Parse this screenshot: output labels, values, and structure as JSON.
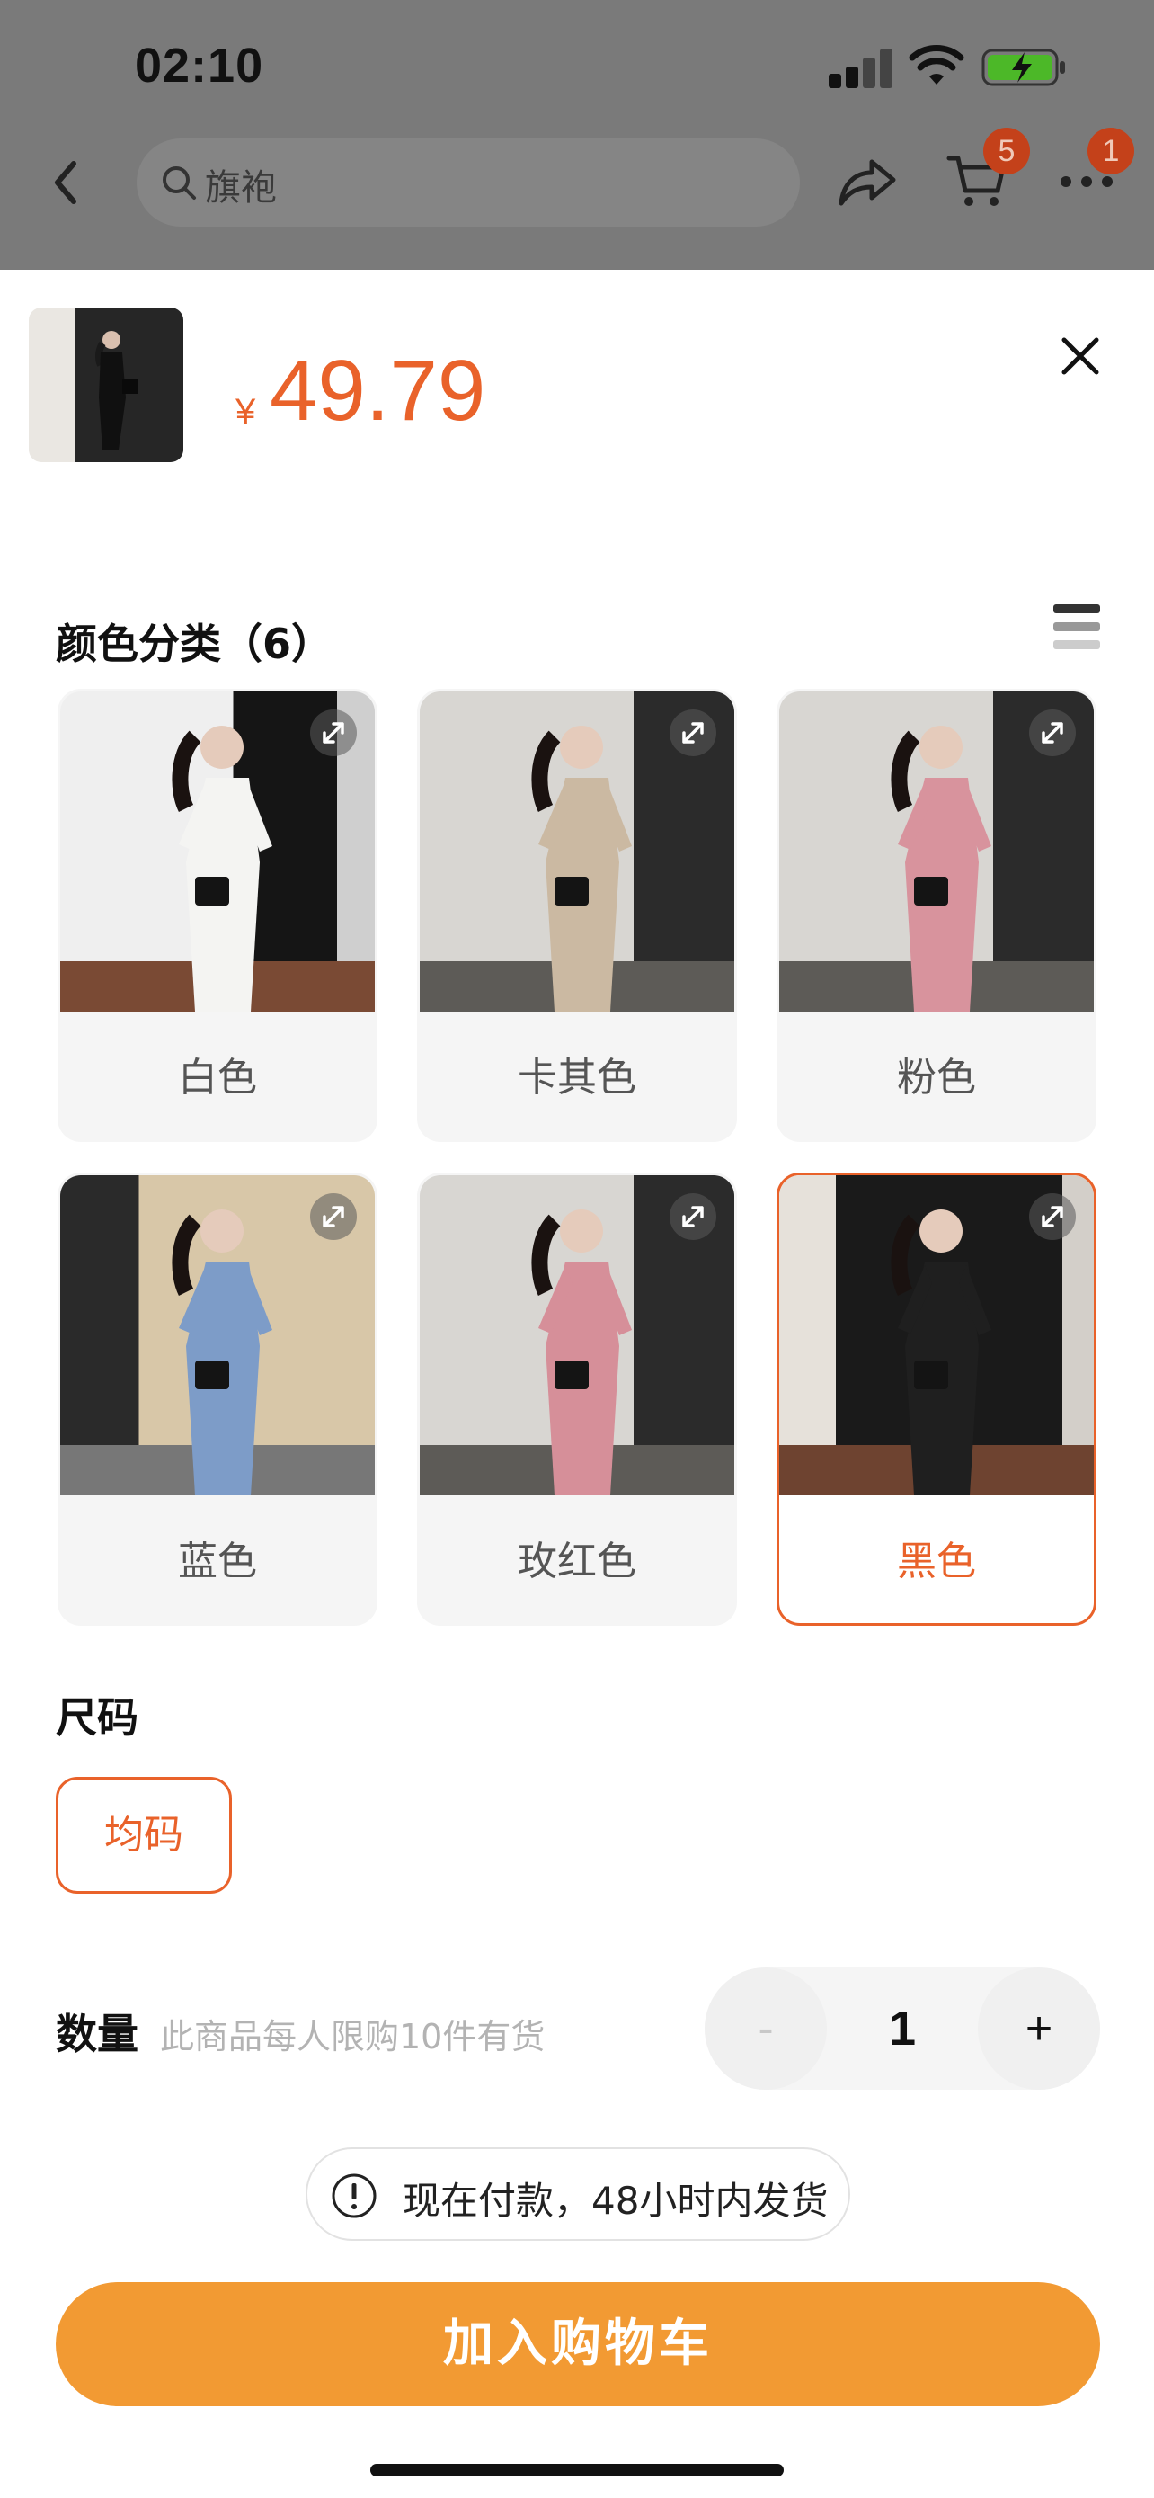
{
  "status_bar": {
    "time": "02:10"
  },
  "nav": {
    "search_placeholder": "旗袍",
    "cart_badge": "5",
    "more_badge": "1"
  },
  "product": {
    "currency": "¥",
    "price": "49.79"
  },
  "color_section": {
    "title": "颜色分类（6）",
    "options": [
      {
        "label": "白色",
        "dress_color": "#f4f4f2",
        "selected": false
      },
      {
        "label": "卡其色",
        "dress_color": "#cbb9a2",
        "selected": false
      },
      {
        "label": "粉色",
        "dress_color": "#d8939d",
        "selected": false
      },
      {
        "label": "蓝色",
        "dress_color": "#7d9cc8",
        "selected": false
      },
      {
        "label": "玫红色",
        "dress_color": "#d68f99",
        "selected": false
      },
      {
        "label": "黑色",
        "dress_color": "#1f1f1f",
        "selected": true
      }
    ]
  },
  "size_section": {
    "title": "尺码",
    "options": [
      "均码"
    ],
    "selected": "均码"
  },
  "quantity": {
    "title": "数量",
    "note": "此商品每人限购10件有货",
    "minus": "-",
    "value": "1",
    "plus": "+"
  },
  "shipping_note": "现在付款，48小时内发货",
  "add_to_cart": "加入购物车",
  "colors": {
    "accent": "#e9622a",
    "button": "#f29a33",
    "badge": "#c4411a",
    "overlay": "#7a7a7a"
  }
}
